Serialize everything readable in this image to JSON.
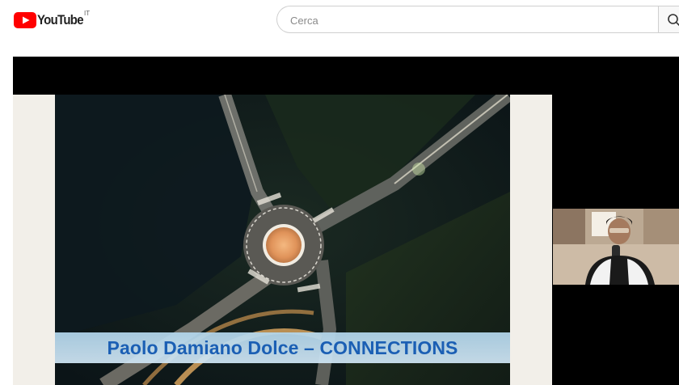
{
  "header": {
    "logo_text": "YouTube",
    "region_code": "IT",
    "search_placeholder": "Cerca",
    "search_value": ""
  },
  "video": {
    "slide_title": "Paolo Damiano Dolce – CONNECTIONS"
  },
  "colors": {
    "youtube_red": "#ff0000",
    "banner_text": "#1b5fb4",
    "player_bg": "#000000"
  }
}
